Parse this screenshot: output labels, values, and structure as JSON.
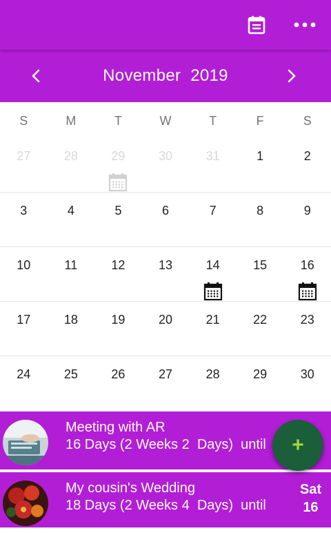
{
  "toolbar": {
    "calendar_icon": "calendar-today-icon",
    "more_icon": "more-horizontal-icon"
  },
  "month_bar": {
    "title": "November  2019",
    "prev_icon": "chevron-left-icon",
    "next_icon": "chevron-right-icon"
  },
  "weekdays": [
    "S",
    "M",
    "T",
    "W",
    "T",
    "F",
    "S"
  ],
  "weeks": [
    [
      {
        "day": "27",
        "other": true
      },
      {
        "day": "28",
        "other": true
      },
      {
        "day": "29",
        "other": true,
        "event": true
      },
      {
        "day": "30",
        "other": true
      },
      {
        "day": "31",
        "other": true
      },
      {
        "day": "1"
      },
      {
        "day": "2"
      }
    ],
    [
      {
        "day": "3"
      },
      {
        "day": "4"
      },
      {
        "day": "5"
      },
      {
        "day": "6"
      },
      {
        "day": "7"
      },
      {
        "day": "8"
      },
      {
        "day": "9"
      }
    ],
    [
      {
        "day": "10"
      },
      {
        "day": "11"
      },
      {
        "day": "12"
      },
      {
        "day": "13"
      },
      {
        "day": "14",
        "event": true
      },
      {
        "day": "15"
      },
      {
        "day": "16",
        "event": true
      }
    ],
    [
      {
        "day": "17"
      },
      {
        "day": "18"
      },
      {
        "day": "19"
      },
      {
        "day": "20"
      },
      {
        "day": "21"
      },
      {
        "day": "22"
      },
      {
        "day": "23"
      }
    ],
    [
      {
        "day": "24"
      },
      {
        "day": "25"
      },
      {
        "day": "26"
      },
      {
        "day": "27"
      },
      {
        "day": "28"
      },
      {
        "day": "29"
      },
      {
        "day": "30"
      }
    ]
  ],
  "events": [
    {
      "title": "Meeting with AR",
      "subtitle": "16 Days (2 Weeks 2  Days)  until",
      "day_name": "",
      "day_num": ""
    },
    {
      "title": "My cousin's Wedding",
      "subtitle": "18 Days (2 Weeks 4  Days)  until",
      "day_name": "Sat",
      "day_num": "16"
    }
  ],
  "fab": {
    "label": "+"
  },
  "colors": {
    "primary": "#b21ed6",
    "fab": "#1b5e3a",
    "fab_plus": "#a5d63a",
    "muted_day": "#d8d8d8"
  }
}
